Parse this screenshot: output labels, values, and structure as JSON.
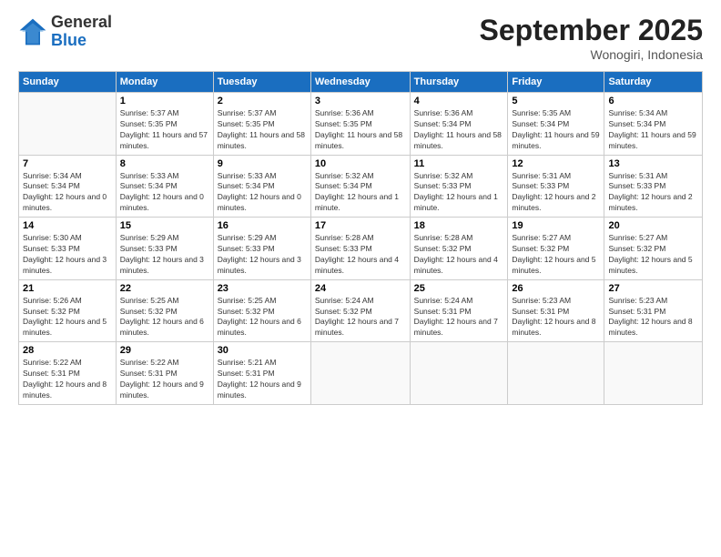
{
  "header": {
    "logo_general": "General",
    "logo_blue": "Blue",
    "month_title": "September 2025",
    "location": "Wonogiri, Indonesia"
  },
  "days_of_week": [
    "Sunday",
    "Monday",
    "Tuesday",
    "Wednesday",
    "Thursday",
    "Friday",
    "Saturday"
  ],
  "weeks": [
    [
      {
        "day": "",
        "sunrise": "",
        "sunset": "",
        "daylight": ""
      },
      {
        "day": "1",
        "sunrise": "Sunrise: 5:37 AM",
        "sunset": "Sunset: 5:35 PM",
        "daylight": "Daylight: 11 hours and 57 minutes."
      },
      {
        "day": "2",
        "sunrise": "Sunrise: 5:37 AM",
        "sunset": "Sunset: 5:35 PM",
        "daylight": "Daylight: 11 hours and 58 minutes."
      },
      {
        "day": "3",
        "sunrise": "Sunrise: 5:36 AM",
        "sunset": "Sunset: 5:35 PM",
        "daylight": "Daylight: 11 hours and 58 minutes."
      },
      {
        "day": "4",
        "sunrise": "Sunrise: 5:36 AM",
        "sunset": "Sunset: 5:34 PM",
        "daylight": "Daylight: 11 hours and 58 minutes."
      },
      {
        "day": "5",
        "sunrise": "Sunrise: 5:35 AM",
        "sunset": "Sunset: 5:34 PM",
        "daylight": "Daylight: 11 hours and 59 minutes."
      },
      {
        "day": "6",
        "sunrise": "Sunrise: 5:34 AM",
        "sunset": "Sunset: 5:34 PM",
        "daylight": "Daylight: 11 hours and 59 minutes."
      }
    ],
    [
      {
        "day": "7",
        "sunrise": "Sunrise: 5:34 AM",
        "sunset": "Sunset: 5:34 PM",
        "daylight": "Daylight: 12 hours and 0 minutes."
      },
      {
        "day": "8",
        "sunrise": "Sunrise: 5:33 AM",
        "sunset": "Sunset: 5:34 PM",
        "daylight": "Daylight: 12 hours and 0 minutes."
      },
      {
        "day": "9",
        "sunrise": "Sunrise: 5:33 AM",
        "sunset": "Sunset: 5:34 PM",
        "daylight": "Daylight: 12 hours and 0 minutes."
      },
      {
        "day": "10",
        "sunrise": "Sunrise: 5:32 AM",
        "sunset": "Sunset: 5:34 PM",
        "daylight": "Daylight: 12 hours and 1 minute."
      },
      {
        "day": "11",
        "sunrise": "Sunrise: 5:32 AM",
        "sunset": "Sunset: 5:33 PM",
        "daylight": "Daylight: 12 hours and 1 minute."
      },
      {
        "day": "12",
        "sunrise": "Sunrise: 5:31 AM",
        "sunset": "Sunset: 5:33 PM",
        "daylight": "Daylight: 12 hours and 2 minutes."
      },
      {
        "day": "13",
        "sunrise": "Sunrise: 5:31 AM",
        "sunset": "Sunset: 5:33 PM",
        "daylight": "Daylight: 12 hours and 2 minutes."
      }
    ],
    [
      {
        "day": "14",
        "sunrise": "Sunrise: 5:30 AM",
        "sunset": "Sunset: 5:33 PM",
        "daylight": "Daylight: 12 hours and 3 minutes."
      },
      {
        "day": "15",
        "sunrise": "Sunrise: 5:29 AM",
        "sunset": "Sunset: 5:33 PM",
        "daylight": "Daylight: 12 hours and 3 minutes."
      },
      {
        "day": "16",
        "sunrise": "Sunrise: 5:29 AM",
        "sunset": "Sunset: 5:33 PM",
        "daylight": "Daylight: 12 hours and 3 minutes."
      },
      {
        "day": "17",
        "sunrise": "Sunrise: 5:28 AM",
        "sunset": "Sunset: 5:33 PM",
        "daylight": "Daylight: 12 hours and 4 minutes."
      },
      {
        "day": "18",
        "sunrise": "Sunrise: 5:28 AM",
        "sunset": "Sunset: 5:32 PM",
        "daylight": "Daylight: 12 hours and 4 minutes."
      },
      {
        "day": "19",
        "sunrise": "Sunrise: 5:27 AM",
        "sunset": "Sunset: 5:32 PM",
        "daylight": "Daylight: 12 hours and 5 minutes."
      },
      {
        "day": "20",
        "sunrise": "Sunrise: 5:27 AM",
        "sunset": "Sunset: 5:32 PM",
        "daylight": "Daylight: 12 hours and 5 minutes."
      }
    ],
    [
      {
        "day": "21",
        "sunrise": "Sunrise: 5:26 AM",
        "sunset": "Sunset: 5:32 PM",
        "daylight": "Daylight: 12 hours and 5 minutes."
      },
      {
        "day": "22",
        "sunrise": "Sunrise: 5:25 AM",
        "sunset": "Sunset: 5:32 PM",
        "daylight": "Daylight: 12 hours and 6 minutes."
      },
      {
        "day": "23",
        "sunrise": "Sunrise: 5:25 AM",
        "sunset": "Sunset: 5:32 PM",
        "daylight": "Daylight: 12 hours and 6 minutes."
      },
      {
        "day": "24",
        "sunrise": "Sunrise: 5:24 AM",
        "sunset": "Sunset: 5:32 PM",
        "daylight": "Daylight: 12 hours and 7 minutes."
      },
      {
        "day": "25",
        "sunrise": "Sunrise: 5:24 AM",
        "sunset": "Sunset: 5:31 PM",
        "daylight": "Daylight: 12 hours and 7 minutes."
      },
      {
        "day": "26",
        "sunrise": "Sunrise: 5:23 AM",
        "sunset": "Sunset: 5:31 PM",
        "daylight": "Daylight: 12 hours and 8 minutes."
      },
      {
        "day": "27",
        "sunrise": "Sunrise: 5:23 AM",
        "sunset": "Sunset: 5:31 PM",
        "daylight": "Daylight: 12 hours and 8 minutes."
      }
    ],
    [
      {
        "day": "28",
        "sunrise": "Sunrise: 5:22 AM",
        "sunset": "Sunset: 5:31 PM",
        "daylight": "Daylight: 12 hours and 8 minutes."
      },
      {
        "day": "29",
        "sunrise": "Sunrise: 5:22 AM",
        "sunset": "Sunset: 5:31 PM",
        "daylight": "Daylight: 12 hours and 9 minutes."
      },
      {
        "day": "30",
        "sunrise": "Sunrise: 5:21 AM",
        "sunset": "Sunset: 5:31 PM",
        "daylight": "Daylight: 12 hours and 9 minutes."
      },
      {
        "day": "",
        "sunrise": "",
        "sunset": "",
        "daylight": ""
      },
      {
        "day": "",
        "sunrise": "",
        "sunset": "",
        "daylight": ""
      },
      {
        "day": "",
        "sunrise": "",
        "sunset": "",
        "daylight": ""
      },
      {
        "day": "",
        "sunrise": "",
        "sunset": "",
        "daylight": ""
      }
    ]
  ]
}
